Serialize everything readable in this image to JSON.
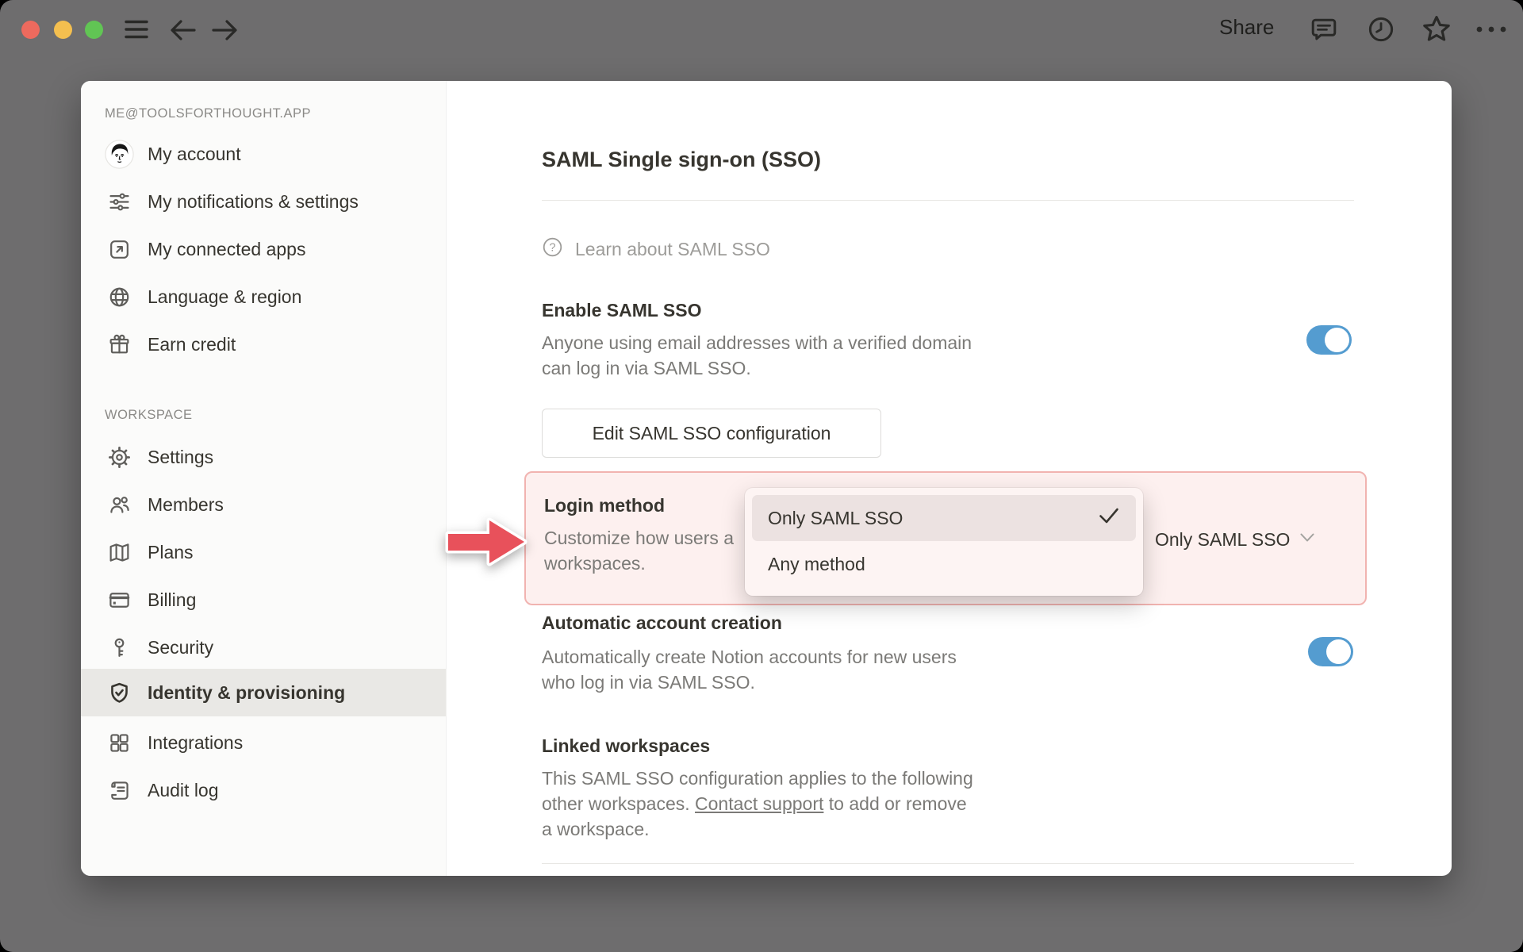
{
  "titlebar": {
    "share_label": "Share"
  },
  "sidebar": {
    "account_section_label": "ME@TOOLSFORTHOUGHT.APP",
    "account_items": [
      {
        "label": "My account"
      },
      {
        "label": "My notifications & settings"
      },
      {
        "label": "My connected apps"
      },
      {
        "label": "Language & region"
      },
      {
        "label": "Earn credit"
      }
    ],
    "workspace_section_label": "WORKSPACE",
    "workspace_items": [
      {
        "label": "Settings"
      },
      {
        "label": "Members"
      },
      {
        "label": "Plans"
      },
      {
        "label": "Billing"
      },
      {
        "label": "Security"
      },
      {
        "label": "Identity & provisioning",
        "selected": true
      },
      {
        "label": "Integrations"
      },
      {
        "label": "Audit log"
      }
    ]
  },
  "main": {
    "title": "SAML Single sign-on (SSO)",
    "learn_link_label": "Learn about SAML SSO",
    "enable_saml": {
      "heading": "Enable SAML SSO",
      "description_lines": [
        "Anyone using email addresses with a verified domain",
        "can log in via SAML SSO."
      ],
      "toggle_state": "on"
    },
    "edit_button_label": "Edit SAML SSO configuration",
    "login_method": {
      "heading": "Login method",
      "description_visible_line1": "Customize how users a",
      "description_visible_line2": "workspaces.",
      "selected_value": "Only SAML SSO",
      "dropdown_options": [
        {
          "label": "Only SAML SSO",
          "checked": true
        },
        {
          "label": "Any method",
          "checked": false
        }
      ]
    },
    "automatic_account_creation": {
      "heading": "Automatic account creation",
      "description_lines": [
        "Automatically create Notion accounts for new users",
        "who log in via SAML SSO."
      ],
      "toggle_state": "on"
    },
    "linked_workspaces": {
      "heading": "Linked workspaces",
      "description_line1": "This SAML SSO configuration applies to the following",
      "description_line2_before_link": "other workspaces. ",
      "description_line2_link": "Contact support",
      "description_line2_after_link": " to add or remove",
      "description_line3": "a workspace."
    }
  },
  "colors": {
    "toggle_on": "#549cd0",
    "highlight_border": "#f1b3b0",
    "highlight_background": "#fdf0ef",
    "arrow_red": "#e8515b",
    "traffic_red": "#ed6a5e",
    "traffic_yellow": "#f4bf4f",
    "traffic_green": "#61c554"
  }
}
